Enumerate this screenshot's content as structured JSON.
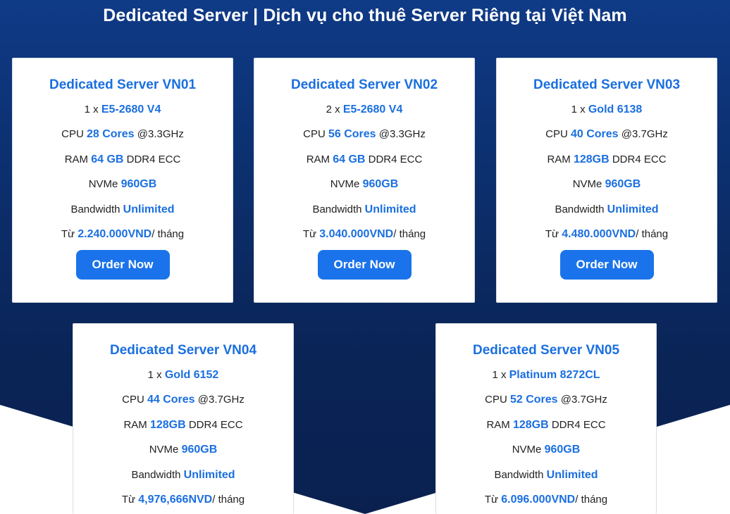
{
  "page": {
    "title": "Dedicated Server | Dịch vụ cho thuê Server Riêng tại Việt Nam"
  },
  "labels": {
    "cpu": "CPU",
    "ram": "RAM",
    "nvme": "NVMe",
    "bandwidth": "Bandwidth",
    "from": "Từ",
    "per_month": "/ tháng",
    "order": "Order Now"
  },
  "plans": [
    {
      "name": "Dedicated Server VN01",
      "cpu_qty": "1 x",
      "cpu_model": "E5-2680 V4",
      "cores": "28 Cores",
      "clock": "@3.3GHz",
      "ram": "64 GB",
      "ram_type": "DDR4 ECC",
      "nvme": "960GB",
      "bandwidth": "Unlimited",
      "price": "2.240.000VND"
    },
    {
      "name": "Dedicated Server VN02",
      "cpu_qty": "2 x",
      "cpu_model": "E5-2680 V4",
      "cores": "56 Cores",
      "clock": "@3.3GHz",
      "ram": "64 GB",
      "ram_type": "DDR4 ECC",
      "nvme": "960GB",
      "bandwidth": "Unlimited",
      "price": "3.040.000VND"
    },
    {
      "name": "Dedicated Server VN03",
      "cpu_qty": "1 x",
      "cpu_model": "Gold 6138",
      "cores": "40 Cores",
      "clock": "@3.7GHz",
      "ram": "128GB",
      "ram_type": "DDR4 ECC",
      "nvme": "960GB",
      "bandwidth": "Unlimited",
      "price": "4.480.000VND"
    },
    {
      "name": "Dedicated Server VN04",
      "cpu_qty": "1 x",
      "cpu_model": "Gold 6152",
      "cores": "44 Cores",
      "clock": "@3.7GHz",
      "ram": "128GB",
      "ram_type": "DDR4 ECC",
      "nvme": "960GB",
      "bandwidth": "Unlimited",
      "price": "4,976,666NVD"
    },
    {
      "name": "Dedicated Server VN05",
      "cpu_qty": "1 x",
      "cpu_model": "Platinum 8272CL",
      "cores": "52 Cores",
      "clock": "@3.7GHz",
      "ram": "128GB",
      "ram_type": "DDR4 ECC",
      "nvme": "960GB",
      "bandwidth": "Unlimited",
      "price": "6.096.000VND"
    }
  ],
  "colors": {
    "accent": "#1a6fe0",
    "button": "#1a73ea",
    "background": "#0c2f6d"
  }
}
